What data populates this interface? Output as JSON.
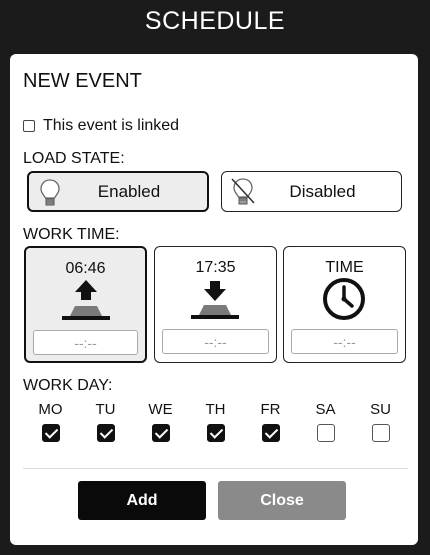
{
  "header": {
    "title": "SCHEDULE"
  },
  "panel": {
    "heading": "NEW EVENT",
    "linked_label": "This event is linked",
    "linked_checked": false
  },
  "load_state": {
    "label": "LOAD STATE:",
    "options": [
      {
        "label": "Enabled",
        "icon": "lightbulb-icon",
        "selected": true
      },
      {
        "label": "Disabled",
        "icon": "lightbulb-off-icon",
        "selected": false
      }
    ]
  },
  "work_time": {
    "label": "WORK TIME:",
    "cards": [
      {
        "time": "06:46",
        "icon": "sunrise-icon",
        "placeholder": "--:--",
        "selected": true
      },
      {
        "time": "17:35",
        "icon": "sunset-icon",
        "placeholder": "--:--",
        "selected": false
      },
      {
        "time": "TIME",
        "icon": "clock-icon",
        "placeholder": "--:--",
        "selected": false
      }
    ]
  },
  "work_day": {
    "label": "WORK DAY:",
    "days": [
      {
        "label": "MO",
        "checked": true
      },
      {
        "label": "TU",
        "checked": true
      },
      {
        "label": "WE",
        "checked": true
      },
      {
        "label": "TH",
        "checked": true
      },
      {
        "label": "FR",
        "checked": true
      },
      {
        "label": "SA",
        "checked": false
      },
      {
        "label": "SU",
        "checked": false
      }
    ]
  },
  "actions": {
    "add_label": "Add",
    "close_label": "Close"
  },
  "colors": {
    "background": "#1b1b1b",
    "add_button": "#0a0a0a",
    "close_button": "#8a8a8a"
  }
}
